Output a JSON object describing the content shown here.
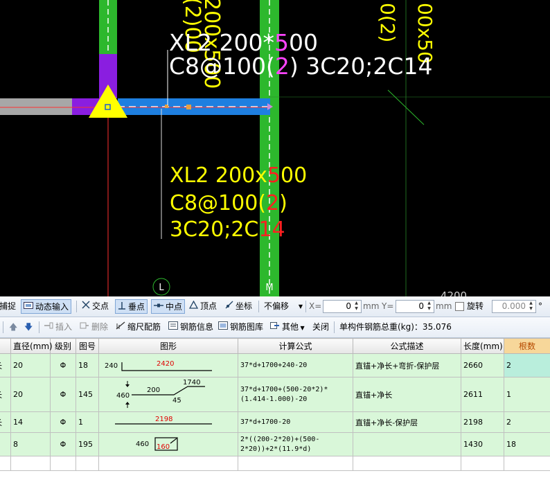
{
  "cad": {
    "labels": {
      "top_line1_a": "XL2 200*",
      "top_line1_b": "5",
      "top_line1_c": "00",
      "top_line2_a": "C8@100(",
      "top_line2_b": "2",
      "top_line2_c": ") 3C20;2C14",
      "low_line1_a": "XL2 200x",
      "low_line1_b": "5",
      "low_line1_c": "00",
      "low_line2_a": "C8@100(",
      "low_line2_b": "2",
      "low_line2_c": ")",
      "low_line3_a": "3C20;2C",
      "low_line3_b": "14",
      "vert_left": "200x500",
      "vert_left2": "(2)00",
      "vert_right_a": "0(2)",
      "vert_right_b": "00x50",
      "axis_l": "L",
      "axis_m": "M",
      "dim": "4200"
    },
    "colors": {
      "beam_blue": "#1e7fe0",
      "column_green": "#2db82d",
      "purple": "#8a1ee0",
      "label_yellow": "#ffff00",
      "label_red": "#ff2020"
    }
  },
  "snapbar": {
    "capture_label": "捕捉",
    "dynamic_input_label": "动态输入",
    "intersection_label": "交点",
    "perpendicular_label": "垂点",
    "midpoint_label": "中点",
    "vertex_label": "顶点",
    "coordinate_label": "坐标",
    "offset_select": "不偏移",
    "x_label": "X=",
    "x_value": "0",
    "x_unit": "mm",
    "y_label": "Y=",
    "y_value": "0",
    "y_unit": "mm",
    "rotate_label": "旋转",
    "rotate_value": "0.000",
    "degree": "°"
  },
  "toolbar": {
    "insert_label": "插入",
    "delete_label": "删除",
    "scale_label": "缩尺配筋",
    "rebar_info_label": "钢筋信息",
    "rebar_lib_label": "钢筋图库",
    "other_label": "其他",
    "close_label": "关闭",
    "total_weight_label": "单构件钢筋总重(kg)：35.076"
  },
  "grid": {
    "headers": {
      "name": "",
      "diameter": "直径(mm)",
      "grade": "级别",
      "shape_no": "图号",
      "shape": "图形",
      "formula": "计算公式",
      "description": "公式描述",
      "length": "长度(mm)",
      "count": "根数"
    },
    "grade_symbol": "Φ",
    "rows": [
      {
        "name": "长",
        "diameter": "20",
        "grade": "Φ",
        "shape_no": "18",
        "formula": "37*d+1700+240-20",
        "description": "直锚+净长+弯折-保护层",
        "length": "2660",
        "count": "2",
        "shape": {
          "left": "240",
          "top": "2420"
        }
      },
      {
        "name": "长",
        "diameter": "20",
        "grade": "Φ",
        "shape_no": "145",
        "formula": "37*d+1700+(500-20*2)*(1.414-1.000)-20",
        "description": "直锚+净长",
        "length": "2611",
        "count": "1",
        "shape": {
          "a": "1740",
          "b": "460",
          "c": "200",
          "d": "45"
        }
      },
      {
        "name": "长",
        "diameter": "14",
        "grade": "Φ",
        "shape_no": "1",
        "formula": "37*d+1700-20",
        "description": "直锚+净长-保护层",
        "length": "2198",
        "count": "2",
        "shape": {
          "top": "2198"
        }
      },
      {
        "name": "",
        "diameter": "8",
        "grade": "Φ",
        "shape_no": "195",
        "formula": "2*((200-2*20)+(500-2*20))+2*(11.9*d)",
        "description": "",
        "length": "1430",
        "count": "18",
        "shape": {
          "a": "460",
          "b": "160"
        }
      }
    ]
  }
}
